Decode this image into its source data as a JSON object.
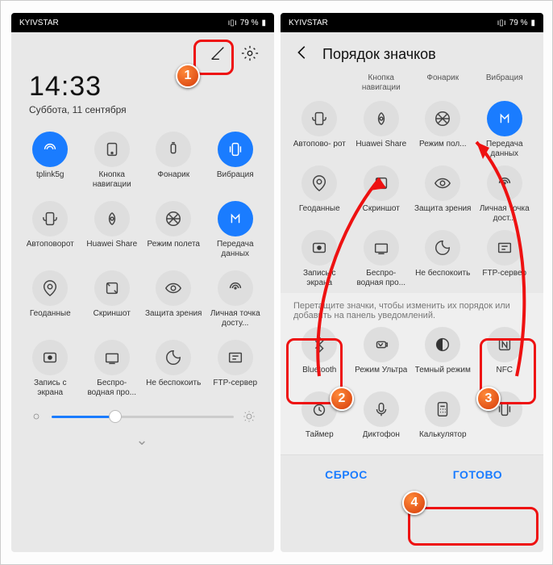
{
  "status": {
    "carrier": "KYIVSTAR",
    "battery": "79 %"
  },
  "left": {
    "time": "14:33",
    "date": "Суббота, 11 сентября",
    "tiles": [
      {
        "label": "tplink5g",
        "on": true
      },
      {
        "label": "Кнопка навигации"
      },
      {
        "label": "Фонарик"
      },
      {
        "label": "Вибрация",
        "on": true
      },
      {
        "label": "Автоповорот"
      },
      {
        "label": "Huawei Share"
      },
      {
        "label": "Режим полета"
      },
      {
        "label": "Передача данных",
        "on": true
      },
      {
        "label": "Геоданные"
      },
      {
        "label": "Скриншот"
      },
      {
        "label": "Защита зрения"
      },
      {
        "label": "Личная точка досту..."
      },
      {
        "label": "Запись с экрана"
      },
      {
        "label": "Беспро- водная про..."
      },
      {
        "label": "Не беспокоить"
      },
      {
        "label": "FTP-сервер"
      }
    ]
  },
  "right": {
    "title": "Порядок значков",
    "row0": [
      {
        "label": ""
      },
      {
        "label": "Кнопка навигации"
      },
      {
        "label": "Фонарик"
      },
      {
        "label": "Вибрация"
      }
    ],
    "row1": [
      {
        "label": "Автопово- рот"
      },
      {
        "label": "Huawei Share"
      },
      {
        "label": "Режим пол..."
      },
      {
        "label": "Передача данных",
        "on": true
      }
    ],
    "row2": [
      {
        "label": "Геоданные"
      },
      {
        "label": "Скриншот"
      },
      {
        "label": "Защита зрения"
      },
      {
        "label": "Личная точка дост..."
      }
    ],
    "row3": [
      {
        "label": "Запись с экрана"
      },
      {
        "label": "Беспро- водная про..."
      },
      {
        "label": "Не беспокоить"
      },
      {
        "label": "FTP-сервер"
      }
    ],
    "hint": "Перетащите значки, чтобы изменить их порядок или добавить на панель уведомлений.",
    "row4": [
      {
        "label": "Bluetooth"
      },
      {
        "label": "Режим Ультра"
      },
      {
        "label": "Темный режим"
      },
      {
        "label": "NFC"
      }
    ],
    "row5": [
      {
        "label": "Таймер"
      },
      {
        "label": "Диктофон"
      },
      {
        "label": "Калькулятор"
      },
      {
        "label": ""
      }
    ],
    "reset": "СБРОС",
    "done": "ГОТОВО"
  },
  "badges": {
    "1": "1",
    "2": "2",
    "3": "3",
    "4": "4"
  }
}
